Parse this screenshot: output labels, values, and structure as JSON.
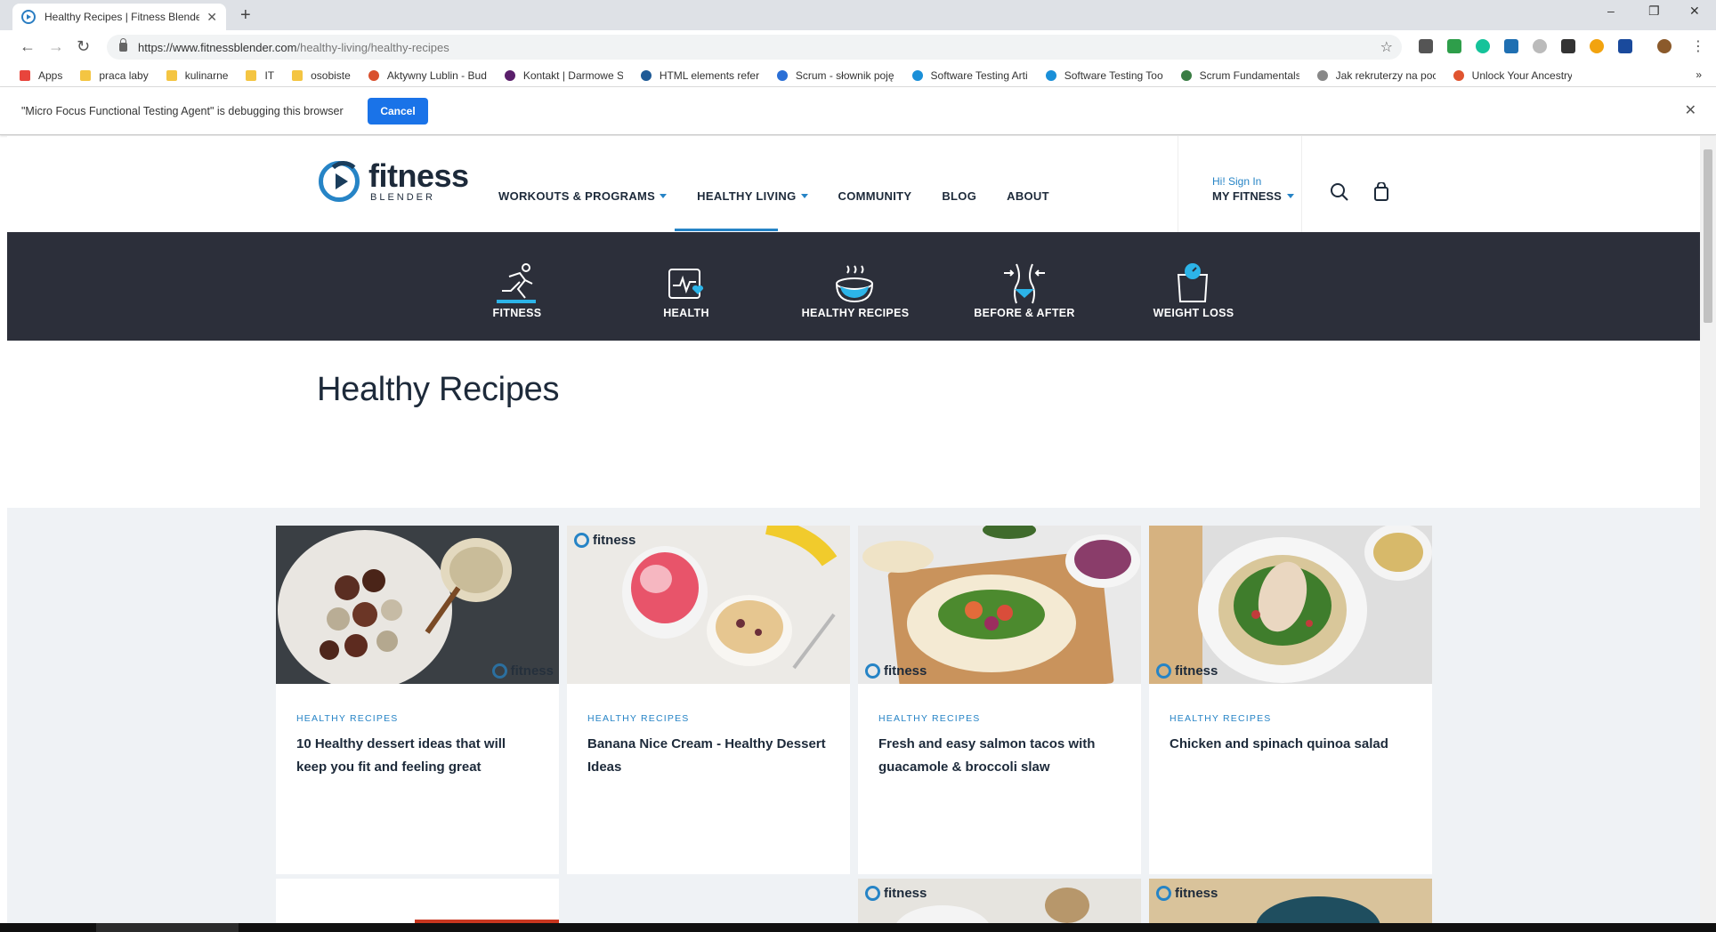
{
  "browser": {
    "tab_title": "Healthy Recipes | Fitness Blender",
    "tab_close": "✕",
    "new_tab": "+",
    "url_host": "https://www.fitnessblender.com",
    "url_path": "/healthy-living/healthy-recipes",
    "window_controls": [
      "–",
      "❐",
      "✕"
    ],
    "bookmarks": [
      {
        "label": "Apps",
        "icon": "apps-grid-icon",
        "color": "#e8453c"
      },
      {
        "label": "praca laby",
        "icon": "folder-icon",
        "color": "#f4c542"
      },
      {
        "label": "kulinarne",
        "icon": "folder-icon",
        "color": "#f4c542"
      },
      {
        "label": "IT",
        "icon": "folder-icon",
        "color": "#f4c542"
      },
      {
        "label": "osobiste",
        "icon": "folder-icon",
        "color": "#f4c542"
      },
      {
        "label": "Aktywny Lublin - Bud",
        "icon": "site-icon",
        "color": "#d9502e"
      },
      {
        "label": "Kontakt | Darmowe S",
        "icon": "site-icon",
        "color": "#5a1f6b"
      },
      {
        "label": "HTML elements refer",
        "icon": "site-icon",
        "color": "#1e5a96"
      },
      {
        "label": "Scrum - słownik poję",
        "icon": "site-icon",
        "color": "#2a6fd6"
      },
      {
        "label": "Software Testing Arti",
        "icon": "site-icon",
        "color": "#1a8fd8"
      },
      {
        "label": "Software Testing Too",
        "icon": "site-icon",
        "color": "#1a8fd8"
      },
      {
        "label": "Scrum Fundamentals",
        "icon": "site-icon",
        "color": "#3a7d44"
      },
      {
        "label": "Jak rekruterzy na poc",
        "icon": "page-icon",
        "color": "#888888"
      },
      {
        "label": "Unlock Your Ancestry",
        "icon": "site-icon",
        "color": "#e0542f"
      }
    ],
    "bookmarks_more": "»",
    "infobar_message": "\"Micro Focus Functional Testing Agent\" is debugging this browser",
    "infobar_cancel": "Cancel",
    "infobar_close": "✕"
  },
  "site": {
    "logo_word": "fitness",
    "logo_sub": "BLENDER",
    "nav": [
      {
        "label": "WORKOUTS & PROGRAMS",
        "dropdown": true
      },
      {
        "label": "HEALTHY LIVING",
        "dropdown": true,
        "active": true
      },
      {
        "label": "COMMUNITY",
        "dropdown": false
      },
      {
        "label": "BLOG",
        "dropdown": false
      },
      {
        "label": "ABOUT",
        "dropdown": false
      }
    ],
    "account_greeting": "Hi! Sign In",
    "account_menu": "MY FITNESS",
    "categories": [
      {
        "label": "FITNESS",
        "icon": "runner-icon"
      },
      {
        "label": "HEALTH",
        "icon": "heart-monitor-icon"
      },
      {
        "label": "HEALTHY RECIPES",
        "icon": "steaming-bowl-icon"
      },
      {
        "label": "BEFORE & AFTER",
        "icon": "waist-icon"
      },
      {
        "label": "WEIGHT LOSS",
        "icon": "scale-icon"
      }
    ],
    "page_title": "Healthy Recipes",
    "watermark": "fitness",
    "cards": [
      {
        "tag": "HEALTHY RECIPES",
        "title": "10 Healthy dessert ideas that will keep you fit and feeling great"
      },
      {
        "tag": "HEALTHY RECIPES",
        "title": "Banana Nice Cream - Healthy Dessert Ideas"
      },
      {
        "tag": "HEALTHY RECIPES",
        "title": "Fresh and easy salmon tacos with guacamole & broccoli slaw"
      },
      {
        "tag": "HEALTHY RECIPES",
        "title": "Chicken and spinach quinoa salad"
      }
    ],
    "accent_color": "#2684c6",
    "band_color": "#2c2f3a"
  }
}
